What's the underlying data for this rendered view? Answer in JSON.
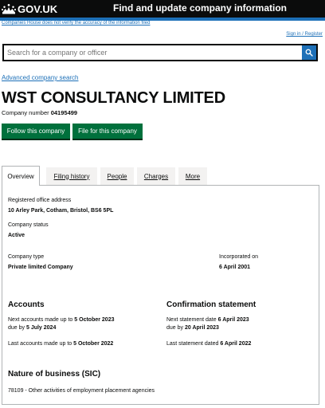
{
  "header": {
    "logo_text": "GOV.UK",
    "service_name": "Find and update company information"
  },
  "notice": "Companies House does not verify the accuracy of the information filed",
  "signin": "Sign in / Register",
  "search": {
    "placeholder": "Search for a company or officer"
  },
  "advanced_search": "Advanced company search",
  "company": {
    "name": "WST CONSULTANCY LIMITED",
    "number_label": "Company number",
    "number": "04195499"
  },
  "buttons": {
    "follow": "Follow this company",
    "file": "File for this company"
  },
  "tabs": [
    {
      "label": "Overview"
    },
    {
      "label": "Filing history"
    },
    {
      "label": "People"
    },
    {
      "label": "Charges"
    },
    {
      "label": "More"
    }
  ],
  "overview": {
    "registered_office_label": "Registered office address",
    "registered_office": "10 Arley Park, Cotham, Bristol, BS6 5PL",
    "status_label": "Company status",
    "status": "Active",
    "type_label": "Company type",
    "type": "Private limited Company",
    "incorporated_label": "Incorporated on",
    "incorporated": "6 April 2001"
  },
  "accounts": {
    "heading": "Accounts",
    "next_prefix": "Next accounts made up to",
    "next_date": "5 October 2023",
    "due_prefix": "due by",
    "due_date": "5 July 2024",
    "last_prefix": "Last accounts made up to",
    "last_date": "5 October 2022"
  },
  "confirmation": {
    "heading": "Confirmation statement",
    "next_prefix": "Next statement date",
    "next_date": "6 April 2023",
    "due_prefix": "due by",
    "due_date": "20 April 2023",
    "last_prefix": "Last statement dated",
    "last_date": "6 April 2022"
  },
  "sic": {
    "heading": "Nature of business (SIC)",
    "item": "78109 - Other activities of employment placement agencies"
  },
  "colors": {
    "header_bg": "#0b0c0c",
    "brand_blue": "#1d70b8",
    "button_green": "#00703c",
    "link": "#1d70b8"
  },
  "icons": {
    "logo": "crown-icon",
    "search": "search-icon"
  }
}
